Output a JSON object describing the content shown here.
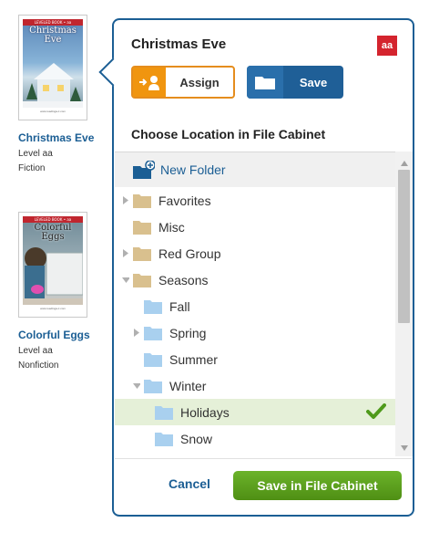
{
  "books": [
    {
      "cover_band": "LEVELED BOOK • aa",
      "cover_title": "Christmas Eve",
      "cover_footer": "www.readinga-z.com",
      "title": "Christmas Eve",
      "level": "Level aa",
      "genre": "Fiction"
    },
    {
      "cover_band": "LEVELED BOOK • aa",
      "cover_title": "Colorful Eggs",
      "cover_footer": "www.readinga-z.com",
      "title": "Colorful Eggs",
      "level": "Level aa",
      "genre": "Nonfiction"
    }
  ],
  "popover": {
    "title": "Christmas Eve",
    "level_badge": "aa",
    "assign_label": "Assign",
    "save_label": "Save",
    "section_heading": "Choose Location in File Cabinet",
    "new_folder_label": "New Folder",
    "tree": [
      {
        "label": "Favorites",
        "depth": 0,
        "caret": "collapsed",
        "color": "tan"
      },
      {
        "label": "Misc",
        "depth": 0,
        "caret": "none",
        "color": "tan"
      },
      {
        "label": "Red Group",
        "depth": 0,
        "caret": "collapsed",
        "color": "tan"
      },
      {
        "label": "Seasons",
        "depth": 0,
        "caret": "expanded",
        "color": "tan"
      },
      {
        "label": "Fall",
        "depth": 1,
        "caret": "none",
        "color": "blue"
      },
      {
        "label": "Spring",
        "depth": 1,
        "caret": "collapsed",
        "color": "blue"
      },
      {
        "label": "Summer",
        "depth": 1,
        "caret": "none",
        "color": "blue"
      },
      {
        "label": "Winter",
        "depth": 1,
        "caret": "expanded",
        "color": "blue"
      },
      {
        "label": "Holidays",
        "depth": 2,
        "caret": "none",
        "color": "blue",
        "selected": true
      },
      {
        "label": "Snow",
        "depth": 2,
        "caret": "none",
        "color": "blue"
      }
    ],
    "cancel_label": "Cancel",
    "confirm_label": "Save in File Cabinet"
  },
  "colors": {
    "brand_blue": "#1b5e94",
    "assign_orange": "#f0950f",
    "confirm_green": "#5ba11b",
    "selected_row": "#e5f0d8",
    "folder_tan": "#d9c08e",
    "folder_blue": "#a9d0ef",
    "badge_red": "#d4242e"
  }
}
